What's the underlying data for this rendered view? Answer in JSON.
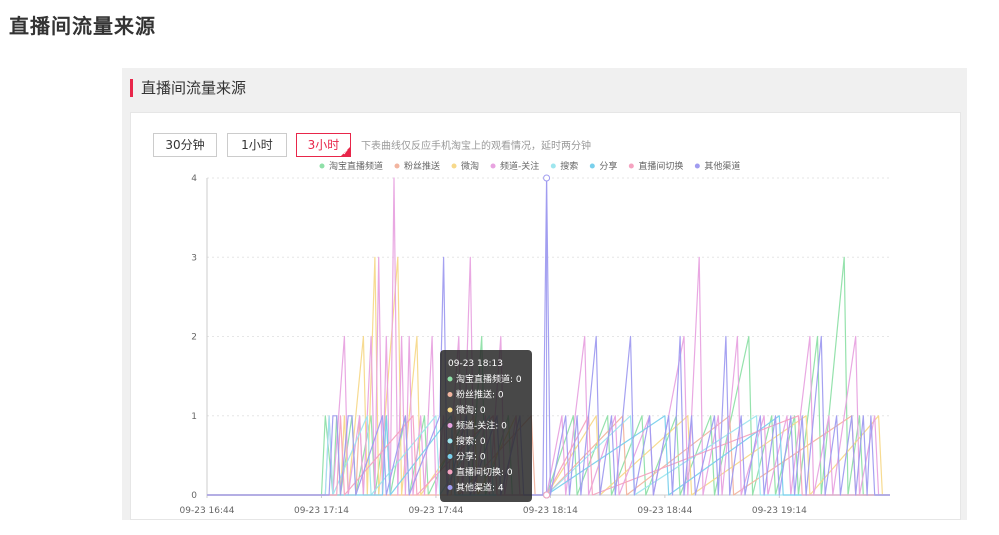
{
  "page": {
    "title": "直播间流量来源"
  },
  "panel": {
    "title": "直播间流量来源"
  },
  "tabs": [
    {
      "label": "30分钟",
      "active": false
    },
    {
      "label": "1小时",
      "active": false
    },
    {
      "label": "3小时",
      "active": true
    }
  ],
  "note": "下表曲线仅反应手机淘宝上的观看情况，延时两分钟",
  "chart_data": {
    "type": "line",
    "ylim": [
      0,
      4
    ],
    "yticks": [
      0,
      1,
      2,
      3,
      4
    ],
    "xlim": [
      "09-23 16:44",
      "09-23 19:43"
    ],
    "xticks": [
      "09-23 16:44",
      "09-23 17:14",
      "09-23 17:44",
      "09-23 18:14",
      "09-23 18:44",
      "09-23 19:14"
    ],
    "grid": true,
    "legend_position": "top",
    "series": [
      {
        "name": "淘宝直播频道",
        "color": "#8fe0a8",
        "points": [
          [
            "09-23 16:44",
            0
          ],
          [
            "09-23 17:14",
            0
          ],
          [
            "09-23 17:15",
            1
          ],
          [
            "09-23 17:17",
            0
          ],
          [
            "09-23 17:18",
            1
          ],
          [
            "09-23 17:19",
            0
          ],
          [
            "09-23 17:22",
            1
          ],
          [
            "09-23 17:23",
            0
          ],
          [
            "09-23 17:27",
            1
          ],
          [
            "09-23 17:28",
            0
          ],
          [
            "09-23 17:31",
            1
          ],
          [
            "09-23 17:32",
            0
          ],
          [
            "09-23 17:36",
            1
          ],
          [
            "09-23 17:37",
            0
          ],
          [
            "09-23 17:41",
            1
          ],
          [
            "09-23 17:42",
            0
          ],
          [
            "09-23 17:52",
            1
          ],
          [
            "09-23 17:53",
            0
          ],
          [
            "09-23 17:56",
            2
          ],
          [
            "09-23 17:57",
            0
          ],
          [
            "09-23 18:03",
            1
          ],
          [
            "09-23 18:04",
            0
          ],
          [
            "09-23 18:13",
            0
          ],
          [
            "09-23 18:20",
            1
          ],
          [
            "09-23 18:21",
            0
          ],
          [
            "09-23 18:29",
            1
          ],
          [
            "09-23 18:30",
            0
          ],
          [
            "09-23 18:38",
            1
          ],
          [
            "09-23 18:39",
            0
          ],
          [
            "09-23 18:47",
            1
          ],
          [
            "09-23 18:48",
            0
          ],
          [
            "09-23 18:56",
            1
          ],
          [
            "09-23 18:57",
            0
          ],
          [
            "09-23 19:06",
            2
          ],
          [
            "09-23 19:07",
            0
          ],
          [
            "09-23 19:12",
            1
          ],
          [
            "09-23 19:13",
            0
          ],
          [
            "09-23 19:18",
            1
          ],
          [
            "09-23 19:19",
            0
          ],
          [
            "09-23 19:24",
            2
          ],
          [
            "09-23 19:25",
            0
          ],
          [
            "09-23 19:31",
            3
          ],
          [
            "09-23 19:32",
            0
          ],
          [
            "09-23 19:35",
            1
          ],
          [
            "09-23 19:36",
            0
          ],
          [
            "09-23 19:43",
            0
          ]
        ]
      },
      {
        "name": "粉丝推送",
        "color": "#f2b5a0",
        "points": [
          [
            "09-23 16:44",
            0
          ],
          [
            "09-23 17:23",
            0
          ],
          [
            "09-23 17:24",
            1
          ],
          [
            "09-23 17:25",
            0
          ],
          [
            "09-23 17:48",
            0
          ],
          [
            "09-23 17:49",
            1
          ],
          [
            "09-23 17:50",
            0
          ],
          [
            "09-23 18:09",
            1
          ],
          [
            "09-23 18:10",
            0
          ],
          [
            "09-23 18:13",
            0
          ],
          [
            "09-23 18:33",
            1
          ],
          [
            "09-23 18:34",
            0
          ],
          [
            "09-23 19:01",
            1
          ],
          [
            "09-23 19:02",
            0
          ],
          [
            "09-23 19:33",
            1
          ],
          [
            "09-23 19:34",
            0
          ],
          [
            "09-23 19:43",
            0
          ]
        ]
      },
      {
        "name": "微淘",
        "color": "#f7d98b",
        "points": [
          [
            "09-23 16:44",
            0
          ],
          [
            "09-23 17:19",
            0
          ],
          [
            "09-23 17:20",
            1
          ],
          [
            "09-23 17:21",
            0
          ],
          [
            "09-23 17:25",
            2
          ],
          [
            "09-23 17:26",
            0
          ],
          [
            "09-23 17:28",
            3
          ],
          [
            "09-23 17:29",
            0
          ],
          [
            "09-23 17:34",
            3
          ],
          [
            "09-23 17:35",
            0
          ],
          [
            "09-23 17:39",
            2
          ],
          [
            "09-23 17:40",
            0
          ],
          [
            "09-23 17:54",
            1
          ],
          [
            "09-23 17:55",
            0
          ],
          [
            "09-23 18:05",
            1
          ],
          [
            "09-23 18:06",
            0
          ],
          [
            "09-23 18:13",
            0
          ],
          [
            "09-23 18:26",
            1
          ],
          [
            "09-23 18:27",
            0
          ],
          [
            "09-23 18:50",
            1
          ],
          [
            "09-23 18:51",
            0
          ],
          [
            "09-23 19:21",
            1
          ],
          [
            "09-23 19:22",
            0
          ],
          [
            "09-23 19:40",
            1
          ],
          [
            "09-23 19:41",
            0
          ],
          [
            "09-23 19:43",
            0
          ]
        ]
      },
      {
        "name": "频道-关注",
        "color": "#e8a3e0",
        "points": [
          [
            "09-23 16:44",
            0
          ],
          [
            "09-23 17:15",
            0
          ],
          [
            "09-23 17:16",
            1
          ],
          [
            "09-23 17:17",
            0
          ],
          [
            "09-23 17:20",
            2
          ],
          [
            "09-23 17:21",
            0
          ],
          [
            "09-23 17:24",
            1
          ],
          [
            "09-23 17:25",
            0
          ],
          [
            "09-23 17:27",
            2
          ],
          [
            "09-23 17:28",
            0
          ],
          [
            "09-23 17:29",
            3
          ],
          [
            "09-23 17:30",
            0
          ],
          [
            "09-23 17:31",
            2
          ],
          [
            "09-23 17:32",
            0
          ],
          [
            "09-23 17:33",
            4
          ],
          [
            "09-23 17:34",
            0
          ],
          [
            "09-23 17:35",
            2
          ],
          [
            "09-23 17:36",
            0
          ],
          [
            "09-23 17:37",
            2
          ],
          [
            "09-23 17:38",
            0
          ],
          [
            "09-23 17:40",
            1
          ],
          [
            "09-23 17:41",
            0
          ],
          [
            "09-23 17:43",
            2
          ],
          [
            "09-23 17:44",
            0
          ],
          [
            "09-23 17:46",
            1
          ],
          [
            "09-23 17:47",
            0
          ],
          [
            "09-23 17:50",
            2
          ],
          [
            "09-23 17:51",
            0
          ],
          [
            "09-23 17:53",
            3
          ],
          [
            "09-23 17:54",
            0
          ],
          [
            "09-23 17:57",
            1
          ],
          [
            "09-23 17:58",
            0
          ],
          [
            "09-23 18:01",
            2
          ],
          [
            "09-23 18:02",
            0
          ],
          [
            "09-23 18:05",
            1
          ],
          [
            "09-23 18:06",
            0
          ],
          [
            "09-23 18:13",
            0
          ],
          [
            "09-23 18:17",
            1
          ],
          [
            "09-23 18:18",
            0
          ],
          [
            "09-23 18:23",
            2
          ],
          [
            "09-23 18:24",
            0
          ],
          [
            "09-23 18:31",
            1
          ],
          [
            "09-23 18:32",
            0
          ],
          [
            "09-23 18:40",
            1
          ],
          [
            "09-23 18:41",
            0
          ],
          [
            "09-23 18:49",
            2
          ],
          [
            "09-23 18:50",
            0
          ],
          [
            "09-23 18:53",
            3
          ],
          [
            "09-23 18:54",
            0
          ],
          [
            "09-23 18:58",
            1
          ],
          [
            "09-23 18:59",
            0
          ],
          [
            "09-23 19:03",
            2
          ],
          [
            "09-23 19:04",
            0
          ],
          [
            "09-23 19:10",
            1
          ],
          [
            "09-23 19:11",
            0
          ],
          [
            "09-23 19:16",
            1
          ],
          [
            "09-23 19:17",
            0
          ],
          [
            "09-23 19:22",
            2
          ],
          [
            "09-23 19:23",
            0
          ],
          [
            "09-23 19:27",
            1
          ],
          [
            "09-23 19:28",
            0
          ],
          [
            "09-23 19:34",
            2
          ],
          [
            "09-23 19:35",
            0
          ],
          [
            "09-23 19:39",
            1
          ],
          [
            "09-23 19:40",
            0
          ],
          [
            "09-23 19:43",
            0
          ]
        ]
      },
      {
        "name": "搜索",
        "color": "#9fe6ee",
        "points": [
          [
            "09-23 16:44",
            0
          ],
          [
            "09-23 17:15",
            0
          ],
          [
            "09-23 17:16",
            1
          ],
          [
            "09-23 17:17",
            0
          ],
          [
            "09-23 17:26",
            1
          ],
          [
            "09-23 17:27",
            0
          ],
          [
            "09-23 17:44",
            1
          ],
          [
            "09-23 17:45",
            0
          ],
          [
            "09-23 17:58",
            1
          ],
          [
            "09-23 17:59",
            0
          ],
          [
            "09-23 18:13",
            0
          ],
          [
            "09-23 18:35",
            1
          ],
          [
            "09-23 18:36",
            0
          ],
          [
            "09-23 19:08",
            1
          ],
          [
            "09-23 19:09",
            0
          ],
          [
            "09-23 19:43",
            0
          ]
        ]
      },
      {
        "name": "分享",
        "color": "#79d0ec",
        "points": [
          [
            "09-23 16:44",
            0
          ],
          [
            "09-23 17:30",
            0
          ],
          [
            "09-23 17:31",
            1
          ],
          [
            "09-23 17:32",
            0
          ],
          [
            "09-23 17:48",
            1
          ],
          [
            "09-23 17:49",
            0
          ],
          [
            "09-23 18:13",
            0
          ],
          [
            "09-23 18:44",
            1
          ],
          [
            "09-23 18:45",
            0
          ],
          [
            "09-23 19:14",
            1
          ],
          [
            "09-23 19:15",
            0
          ],
          [
            "09-23 19:43",
            0
          ]
        ]
      },
      {
        "name": "直播间切换",
        "color": "#f5a3c0",
        "points": [
          [
            "09-23 16:44",
            0
          ],
          [
            "09-23 17:18",
            0
          ],
          [
            "09-23 17:19",
            1
          ],
          [
            "09-23 17:20",
            0
          ],
          [
            "09-23 17:38",
            1
          ],
          [
            "09-23 17:39",
            0
          ],
          [
            "09-23 17:59",
            1
          ],
          [
            "09-23 18:00",
            0
          ],
          [
            "09-23 18:13",
            0
          ],
          [
            "09-23 18:24",
            1
          ],
          [
            "09-23 18:25",
            0
          ],
          [
            "09-23 19:19",
            1
          ],
          [
            "09-23 19:20",
            0
          ],
          [
            "09-23 19:43",
            0
          ]
        ]
      },
      {
        "name": "其他渠道",
        "color": "#a09cf0",
        "points": [
          [
            "09-23 16:44",
            0
          ],
          [
            "09-23 17:16",
            0
          ],
          [
            "09-23 17:17",
            1
          ],
          [
            "09-23 17:18",
            1
          ],
          [
            "09-23 17:19",
            0
          ],
          [
            "09-23 17:21",
            1
          ],
          [
            "09-23 17:22",
            1
          ],
          [
            "09-23 17:23",
            0
          ],
          [
            "09-23 17:30",
            1
          ],
          [
            "09-23 17:31",
            0
          ],
          [
            "09-23 17:36",
            1
          ],
          [
            "09-23 17:37",
            0
          ],
          [
            "09-23 17:45",
            1
          ],
          [
            "09-23 17:46",
            3
          ],
          [
            "09-23 17:47",
            0
          ],
          [
            "09-23 17:52",
            1
          ],
          [
            "09-23 17:53",
            0
          ],
          [
            "09-23 18:00",
            1
          ],
          [
            "09-23 18:01",
            0
          ],
          [
            "09-23 18:06",
            1
          ],
          [
            "09-23 18:07",
            0
          ],
          [
            "09-23 18:12",
            0
          ],
          [
            "09-23 18:13",
            4
          ],
          [
            "09-23 18:14",
            0
          ],
          [
            "09-23 18:18",
            1
          ],
          [
            "09-23 18:19",
            0
          ],
          [
            "09-23 18:21",
            1
          ],
          [
            "09-23 18:22",
            0
          ],
          [
            "09-23 18:26",
            2
          ],
          [
            "09-23 18:27",
            0
          ],
          [
            "09-23 18:30",
            1
          ],
          [
            "09-23 18:31",
            0
          ],
          [
            "09-23 18:35",
            2
          ],
          [
            "09-23 18:36",
            0
          ],
          [
            "09-23 18:40",
            1
          ],
          [
            "09-23 18:41",
            0
          ],
          [
            "09-23 18:45",
            1
          ],
          [
            "09-23 18:46",
            0
          ],
          [
            "09-23 18:48",
            2
          ],
          [
            "09-23 18:49",
            0
          ],
          [
            "09-23 18:51",
            1
          ],
          [
            "09-23 18:52",
            0
          ],
          [
            "09-23 18:57",
            1
          ],
          [
            "09-23 18:58",
            0
          ],
          [
            "09-23 19:00",
            2
          ],
          [
            "09-23 19:01",
            0
          ],
          [
            "09-23 19:04",
            1
          ],
          [
            "09-23 19:05",
            0
          ],
          [
            "09-23 19:09",
            1
          ],
          [
            "09-23 19:10",
            0
          ],
          [
            "09-23 19:13",
            1
          ],
          [
            "09-23 19:14",
            0
          ],
          [
            "09-23 19:17",
            1
          ],
          [
            "09-23 19:18",
            0
          ],
          [
            "09-23 19:20",
            1
          ],
          [
            "09-23 19:21",
            0
          ],
          [
            "09-23 19:25",
            2
          ],
          [
            "09-23 19:26",
            0
          ],
          [
            "09-23 19:29",
            1
          ],
          [
            "09-23 19:30",
            0
          ],
          [
            "09-23 19:33",
            1
          ],
          [
            "09-23 19:34",
            0
          ],
          [
            "09-23 19:36",
            1
          ],
          [
            "09-23 19:37",
            0
          ],
          [
            "09-23 19:38",
            1
          ],
          [
            "09-23 19:39",
            0
          ],
          [
            "09-23 19:43",
            0
          ]
        ]
      }
    ],
    "tooltip": {
      "title": "09-23 18:13",
      "x": "09-23 18:13",
      "items": [
        {
          "name": "淘宝直播频道",
          "value": 0
        },
        {
          "name": "粉丝推送",
          "value": 0
        },
        {
          "name": "微淘",
          "value": 0
        },
        {
          "name": "频道-关注",
          "value": 0
        },
        {
          "name": "搜索",
          "value": 0
        },
        {
          "name": "分享",
          "value": 0
        },
        {
          "name": "直播间切换",
          "value": 0
        },
        {
          "name": "其他渠道",
          "value": 4
        }
      ]
    }
  }
}
